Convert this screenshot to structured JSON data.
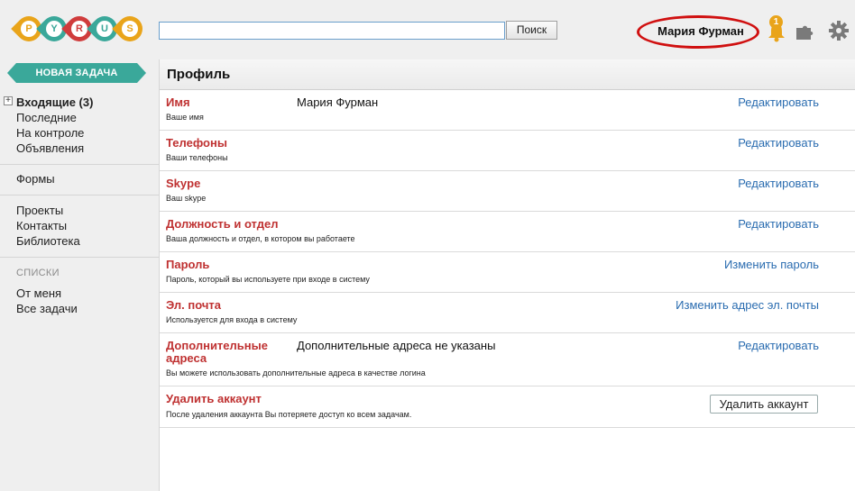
{
  "logo": {
    "letters": [
      {
        "char": "P",
        "color": "#e9a41a"
      },
      {
        "char": "Y",
        "color": "#3aa89a"
      },
      {
        "char": "R",
        "color": "#d03c3c"
      },
      {
        "char": "U",
        "color": "#3aa89a"
      },
      {
        "char": "S",
        "color": "#e9a41a"
      }
    ]
  },
  "header": {
    "search_value": "",
    "search_button": "Поиск",
    "user_name": "Мария Фурман",
    "notifications_count": "1",
    "icons": [
      "bell-icon",
      "puzzle-icon",
      "gear-icon"
    ]
  },
  "sidebar": {
    "new_task": "НОВАЯ ЗАДАЧА",
    "group1": [
      "Входящие (3)",
      "Последние",
      "На контроле",
      "Объявления"
    ],
    "group2": [
      "Формы"
    ],
    "group3": [
      "Проекты",
      "Контакты",
      "Библиотека"
    ],
    "lists_caption": "СПИСКИ",
    "group4": [
      "От меня",
      "Все задачи"
    ]
  },
  "profile": {
    "title": "Профиль",
    "rows": [
      {
        "label": "Имя",
        "desc": "Ваше имя",
        "value": "Мария Фурман",
        "action": "Редактировать"
      },
      {
        "label": "Телефоны",
        "desc": "Ваши телефоны",
        "value": "",
        "action": "Редактировать"
      },
      {
        "label": "Skype",
        "desc": "Ваш skype",
        "value": "",
        "action": "Редактировать"
      },
      {
        "label": "Должность и отдел",
        "desc": "Ваша должность и отдел, в котором вы работаете",
        "value": "",
        "action": "Редактировать"
      },
      {
        "label": "Пароль",
        "desc": "Пароль, который вы используете при входе в систему",
        "value": "",
        "action": "Изменить пароль"
      },
      {
        "label": "Эл. почта",
        "desc": "Используется для входа в систему",
        "value": "",
        "action": "Изменить адрес эл. почты"
      },
      {
        "label": "Дополнительные адреса",
        "desc": "Вы можете использовать дополнительные адреса в качестве логина",
        "value": "Дополнительные адреса не указаны",
        "action": "Редактировать"
      },
      {
        "label": "Удалить аккаунт",
        "desc": "После удаления аккаунта Вы потеряете доступ ко всем задачам.",
        "value": "",
        "action": "Удалить аккаунт"
      }
    ]
  }
}
